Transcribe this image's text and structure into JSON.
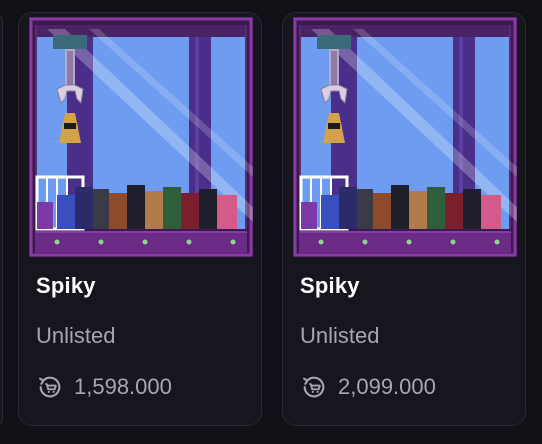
{
  "cards": [
    {
      "name": "Spiky",
      "status": "Unlisted",
      "price": "1,598.000",
      "thumbnail_icon": "claw-machine-icon",
      "price_icon": "cart-refresh-icon"
    },
    {
      "name": "Spiky",
      "status": "Unlisted",
      "price": "2,099.000",
      "thumbnail_icon": "claw-machine-icon",
      "price_icon": "cart-refresh-icon"
    }
  ],
  "colors": {
    "background": "#121017",
    "card": "#17151d",
    "card_border": "#2b2833",
    "machine_frame": "#6b2a86",
    "machine_sky": "#6e9cf0",
    "text_primary": "#ffffff",
    "text_secondary": "#a9a6ae"
  }
}
